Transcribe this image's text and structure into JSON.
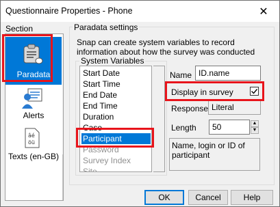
{
  "window": {
    "title": "Questionnaire Properties - Phone",
    "close_glyph": "✕"
  },
  "section": {
    "label": "Section",
    "items": [
      {
        "label": "Paradata",
        "icon": "clipboard-document-icon"
      },
      {
        "label": "Alerts",
        "icon": "user-alert-icon"
      },
      {
        "label": "Texts (en-GB)",
        "icon": "texts-language-icon"
      }
    ]
  },
  "paradata": {
    "group_label": "Paradata settings",
    "description": "Snap can create system variables to record information about how the survey was conducted",
    "system_variables_label": "System Variables",
    "variables": [
      "Start Date",
      "Start Time",
      "End Date",
      "End Time",
      "Duration",
      "Case",
      "Participant",
      "Password",
      "Survey Index",
      "Site"
    ],
    "selected_variable": "Participant",
    "name_label": "Name",
    "name_value": "ID.name",
    "display_label": "Display in survey",
    "display_checked": true,
    "response_label": "Response",
    "response_value": "Literal",
    "length_label": "Length",
    "length_value": "50",
    "detail_text": "Name, login or ID of participant"
  },
  "buttons": {
    "ok": "OK",
    "cancel": "Cancel",
    "help": "Help"
  },
  "colors": {
    "selection": "#0078d7",
    "highlight": "#e8141b"
  }
}
